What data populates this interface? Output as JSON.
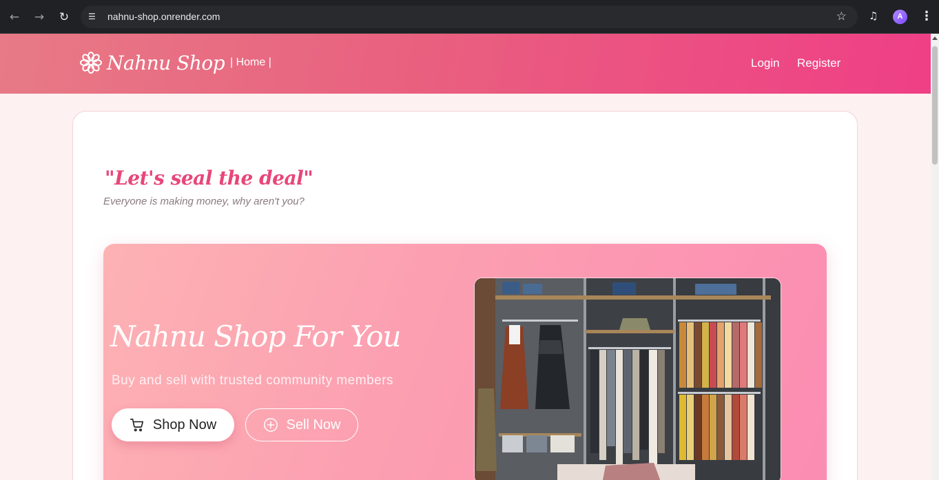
{
  "browser": {
    "url": "nahnu-shop.onrender.com",
    "avatar_letter": "A"
  },
  "header": {
    "brand_name": "Nahnu Shop",
    "home_link": "| Home |",
    "login": "Login",
    "register": "Register"
  },
  "main": {
    "tagline": "\"Let's seal the deal\"",
    "subtagline": "Everyone is making money, why aren't you?"
  },
  "hero": {
    "title": "Nahnu Shop For You",
    "subtitle": "Buy and sell with trusted community members",
    "shop_button": "Shop Now",
    "sell_button": "Sell Now",
    "image": "clothing-store-racks"
  },
  "colors": {
    "header_start": "#e77a86",
    "header_end": "#ef3f86",
    "accent": "#e8467a",
    "hero_start": "#fdb2b4",
    "hero_end": "#fb8cb2"
  }
}
